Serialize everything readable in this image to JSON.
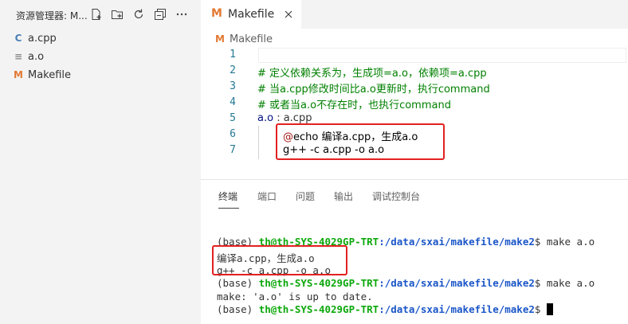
{
  "sidebar": {
    "title": "资源管理器: M...",
    "header_icons": [
      "new-file-icon",
      "new-folder-icon",
      "refresh-icon",
      "collapse-icon",
      "more-icon"
    ],
    "files": [
      {
        "label": "a.cpp",
        "icon": "C",
        "icon_name": "cpp-file-icon",
        "color": "#4a7fb5"
      },
      {
        "label": "a.o",
        "icon": "≡",
        "icon_name": "generic-file-icon",
        "color": "#8a8a8a"
      },
      {
        "label": "Makefile",
        "icon": "M",
        "icon_name": "makefile-icon",
        "color": "#e37933"
      }
    ]
  },
  "editor": {
    "tab": {
      "label": "Makefile",
      "icon": "M"
    },
    "breadcrumb": {
      "label": "Makefile",
      "icon": "M"
    },
    "lines": [
      {
        "num": "1",
        "text": ""
      },
      {
        "num": "2",
        "text": "# 定义依赖关系为，生成项=a.o，依赖项=a.cpp"
      },
      {
        "num": "3",
        "text": "# 当a.cpp修改时间比a.o更新时，执行command"
      },
      {
        "num": "4",
        "text": "# 或者当a.o不存在时，也执行command"
      },
      {
        "num": "5",
        "text_target": "a.o",
        "text_rest": " : a.cpp"
      },
      {
        "num": "6",
        "text_at": "@",
        "text_rest": "echo 编译a.cpp，生成a.o"
      },
      {
        "num": "7",
        "text": "g++ -c a.cpp -o a.o"
      }
    ]
  },
  "panel": {
    "tabs": [
      "终端",
      "端口",
      "问题",
      "输出",
      "调试控制台"
    ],
    "terminal": {
      "prompt_base": "(base) ",
      "user": "th@th-SYS-4029GP-TRT",
      "path": ":/data/sxai/makefile/make2",
      "lines": [
        {
          "cmd": "$ make a.o"
        },
        {
          "output": "编译a.cpp，生成a.o"
        },
        {
          "output": "g++ -c a.cpp -o a.o"
        },
        {
          "cmd": "$ make a.o"
        },
        {
          "output": "make: 'a.o' is up to date."
        },
        {
          "cmd": "$ "
        }
      ]
    }
  },
  "colors": {
    "comment": "#008000",
    "keyword": "#a31515",
    "variable": "#001080",
    "highlight_box": "#e32020",
    "terminal_user": "#0ca80c",
    "terminal_path": "#1b56c8"
  }
}
